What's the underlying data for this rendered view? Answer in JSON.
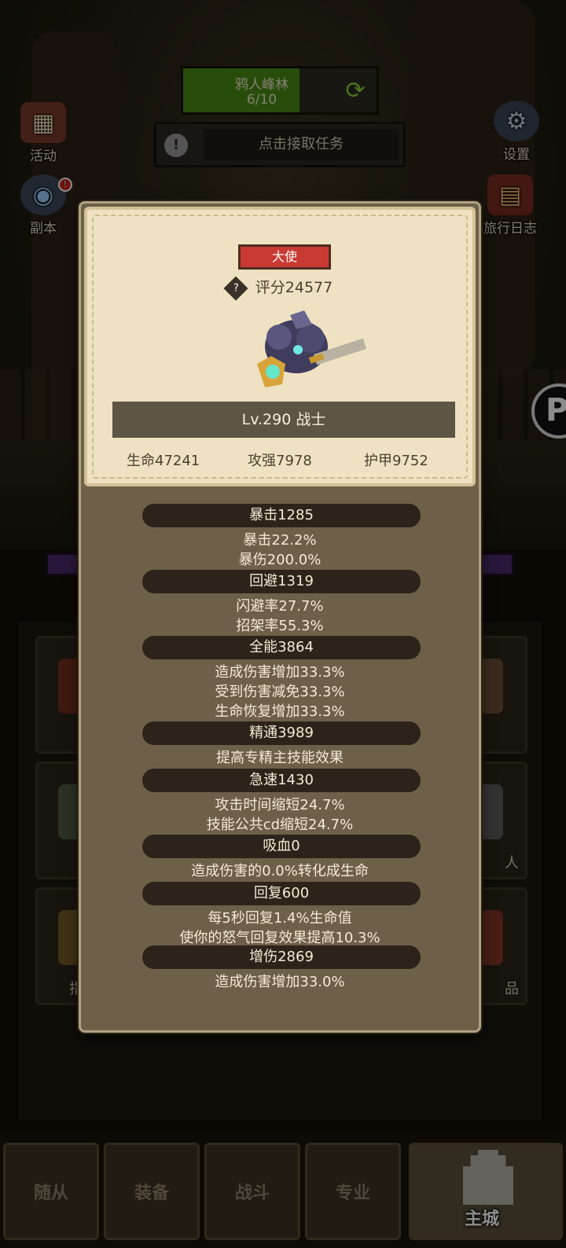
{
  "zone": {
    "name": "鸦人峰林",
    "progress": "6/10",
    "progress_fraction": 0.6
  },
  "task": {
    "label": "点击接取任务"
  },
  "left_menu": [
    {
      "label": "活动",
      "icon": "calendar-icon"
    },
    {
      "label": "副本",
      "icon": "portal-icon",
      "badge": "!"
    }
  ],
  "right_menu": [
    {
      "label": "设置",
      "icon": "gear-icon"
    },
    {
      "label": "旅行日志",
      "icon": "book-icon"
    }
  ],
  "grid_labels": {
    "slot_6": "人",
    "slot_7": "指",
    "slot_8": "品"
  },
  "character": {
    "title": "大使",
    "score": "评分24577",
    "level_class": "Lv.290 战士",
    "hp": "生命47241",
    "attack": "攻强7978",
    "armor": "护甲9752"
  },
  "stat_groups": [
    {
      "header": "暴击1285",
      "lines": [
        "暴击22.2%",
        "暴伤200.0%"
      ]
    },
    {
      "header": "回避1319",
      "lines": [
        "闪避率27.7%",
        "招架率55.3%"
      ]
    },
    {
      "header": "全能3864",
      "lines": [
        "造成伤害增加33.3%",
        "受到伤害减免33.3%",
        "生命恢复增加33.3%"
      ]
    },
    {
      "header": "精通3989",
      "lines": [
        "提高专精主技能效果"
      ]
    },
    {
      "header": "急速1430",
      "lines": [
        "攻击时间缩短24.7%",
        "技能公共cd缩短24.7%"
      ]
    },
    {
      "header": "吸血0",
      "lines": [
        "造成伤害的0.0%转化成生命"
      ]
    },
    {
      "header": "回复600",
      "lines": [
        "每5秒回复1.4%生命值",
        "使你的怒气回复效果提高10.3%"
      ]
    },
    {
      "header": "增伤2869",
      "lines": [
        "造成伤害增加33.0%"
      ]
    }
  ],
  "bottom_nav": [
    {
      "label": "随从"
    },
    {
      "label": "装备"
    },
    {
      "label": "战斗"
    },
    {
      "label": "专业"
    },
    {
      "label": "主城",
      "active": true
    }
  ],
  "colors": {
    "title_badge": "#c93a33",
    "zone_fill": "#4a8c14",
    "modal_bg": "#6d6048",
    "card_bg": "#efe2c2"
  }
}
